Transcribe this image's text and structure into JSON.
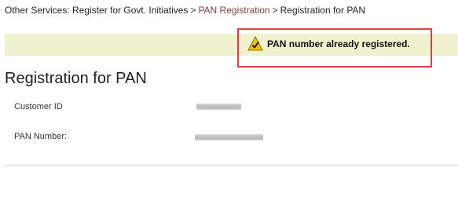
{
  "breadcrumb": {
    "section": "Other Services: Register for Govt. Initiatives",
    "link": "PAN Registration",
    "current": "Registration for PAN",
    "separator": ">"
  },
  "alert": {
    "message": "PAN number already registered.",
    "icon": "warning-check-icon",
    "border_color": "#e04040",
    "background_color": "#eef2cf"
  },
  "page": {
    "title": "Registration for PAN"
  },
  "fields": {
    "customer_id": {
      "label": "Customer ID",
      "value_redacted": true
    },
    "pan_number": {
      "label": "PAN Number:",
      "value_redacted": true
    }
  },
  "colors": {
    "link": "#8b3a3a",
    "text": "#222222"
  }
}
